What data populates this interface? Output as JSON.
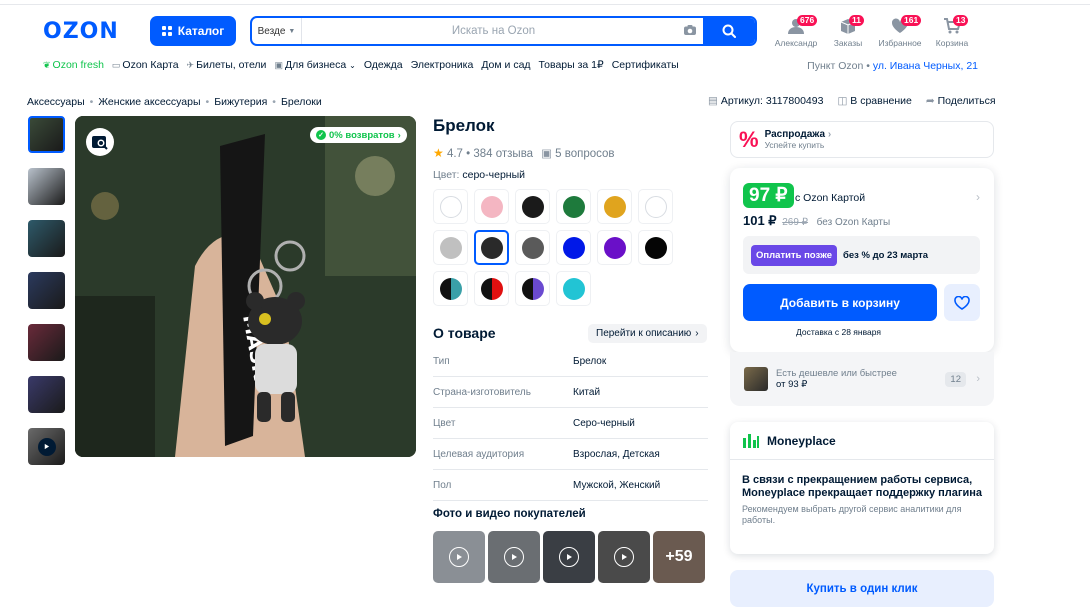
{
  "header": {
    "logo": "OZON",
    "catalog_label": "Каталог",
    "search_scope": "Везде",
    "search_placeholder": "Искать на Ozon",
    "user_icons": [
      {
        "label": "Александр",
        "badge": "676",
        "icon": "profile-icon"
      },
      {
        "label": "Заказы",
        "badge": "11",
        "icon": "box-icon"
      },
      {
        "label": "Избранное",
        "badge": "161",
        "icon": "heart-icon"
      },
      {
        "label": "Корзина",
        "badge": "13",
        "icon": "cart-icon"
      }
    ]
  },
  "nav": {
    "items": [
      "Ozon fresh",
      "Ozon Карта",
      "Билеты, отели",
      "Для бизнеса",
      "Одежда",
      "Электроника",
      "Дом и сад",
      "Товары за 1₽",
      "Сертификаты"
    ],
    "pickup_label": "Пункт Ozon •",
    "pickup_address": "ул. Ивана Черных, 21"
  },
  "breadcrumbs": [
    "Аксессуары",
    "Женские аксессуары",
    "Бижутерия",
    "Брелоки"
  ],
  "meta": {
    "article": "Артикул: 3117800493",
    "compare": "В сравнение",
    "share": "Поделиться"
  },
  "gallery": {
    "returns_badge": "0% возвратов",
    "thumb_colors": [
      "#3a4a38",
      "#b9c2cc",
      "#2e5a6a",
      "#2b3a5e",
      "#6a2a3a",
      "#3a3a6a",
      "#6a6a6a"
    ]
  },
  "product": {
    "title": "Брелок",
    "rating": "4.7 • 384 отзыва",
    "questions": "5 вопросов",
    "color_label": "Цвет:",
    "color_value": "серо-черный",
    "swatches": [
      {
        "c": "#ffffff",
        "c2": "#ffffff"
      },
      {
        "c": "#f4b6c2",
        "c2": "#f4b6c2"
      },
      {
        "c": "#1a1a1a",
        "c2": "#1a1a1a"
      },
      {
        "c": "#1e7a3c",
        "c2": "#1e7a3c"
      },
      {
        "c": "#e0a41e",
        "c2": "#e0a41e"
      },
      {
        "c": "#ffffff",
        "c2": "#ffffff"
      },
      {
        "c": "#c0c0c0",
        "c2": "#c0c0c0"
      },
      {
        "c": "#2a2a2a",
        "c2": "#2a2a2a",
        "selected": true
      },
      {
        "c": "#5a5a5a",
        "c2": "#5a5a5a"
      },
      {
        "c": "#0018e8",
        "c2": "#0018e8"
      },
      {
        "c": "#6a10c8",
        "c2": "#6a10c8"
      },
      {
        "c": "#050505",
        "c2": "#050505"
      },
      {
        "c": "#111111",
        "c2": "#3aa0a8"
      },
      {
        "c": "#111111",
        "c2": "#e01010"
      },
      {
        "c": "#111111",
        "c2": "#6a4ad0"
      },
      {
        "c": "#22c4d4",
        "c2": "#22c4d4"
      }
    ],
    "about_title": "О товаре",
    "goto_desc": "Перейти к описанию",
    "specs": [
      {
        "k": "Тип",
        "v": "Брелок"
      },
      {
        "k": "Страна-изготовитель",
        "v": "Китай"
      },
      {
        "k": "Цвет",
        "v": "Серо-черный"
      },
      {
        "k": "Целевая аудитория",
        "v": "Взрослая, Детская"
      },
      {
        "k": "Пол",
        "v": "Мужской, Женский"
      }
    ],
    "photos_title": "Фото и видео покупателей",
    "photos_more": "+59"
  },
  "sidebar": {
    "sale_title": "Распродажа",
    "sale_sub": "Успейте купить",
    "ozon_price": "97 ₽",
    "ozon_price_label": "с Ozon Картой",
    "price": "101 ₽",
    "old_price": "269 ₽",
    "price_label": "без Ozon Карты",
    "later_btn": "Оплатить позже",
    "later_txt": "без % до 23 марта",
    "add_to_cart": "Добавить в корзину",
    "delivery": "Доставка с 28 января",
    "cheaper_t1": "Есть дешевле или быстрее",
    "cheaper_t2": "от 93 ₽",
    "cheaper_count": "12",
    "mp_title": "Moneyplace",
    "mp_msg": "В связи с прекращением работы сервиса, Moneyplace прекращает поддержку плагина",
    "mp_sub": "Рекомендуем выбрать другой сервис аналитики для работы.",
    "one_click": "Купить в один клик"
  },
  "colors": {
    "accent": "#005bff",
    "green": "#10c44c",
    "pink": "#f91155",
    "purple": "#6a48e7"
  }
}
